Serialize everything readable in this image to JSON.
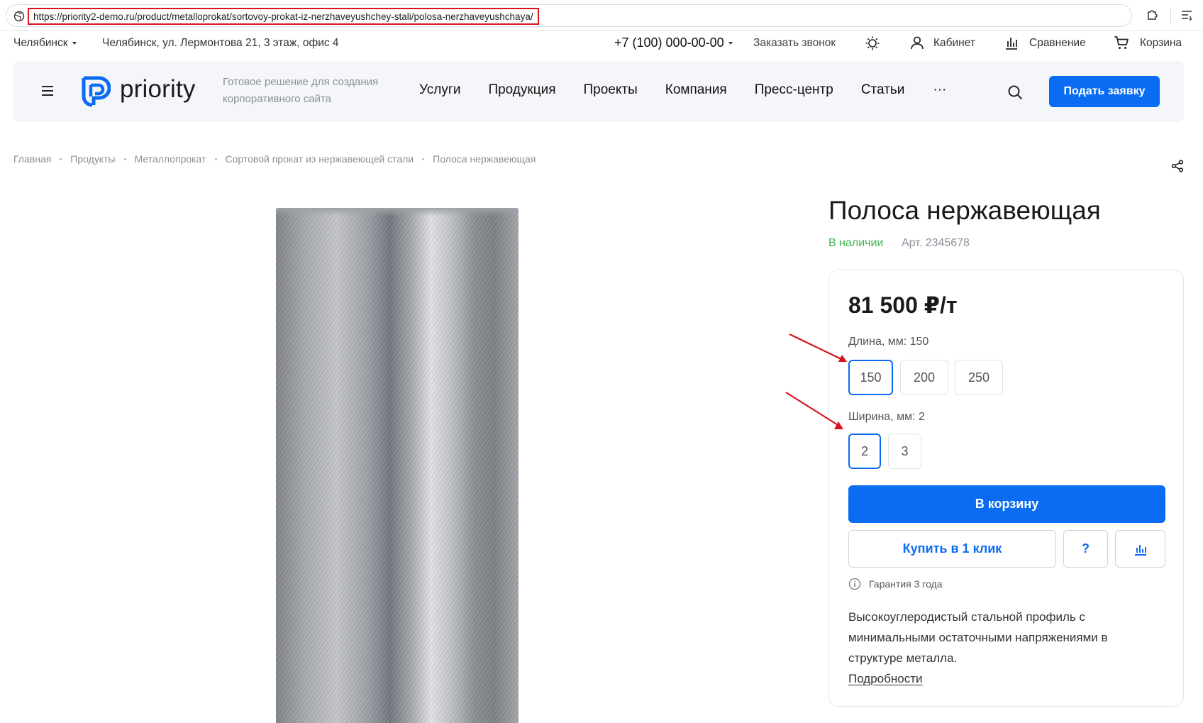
{
  "browser": {
    "url": "https://priority2-demo.ru/product/metalloprokat/sortovoy-prokat-iz-nerzhaveyushchey-stali/polosa-nerzhaveyushchaya/"
  },
  "topbar": {
    "city": "Челябинск",
    "address": "Челябинск, ул. Лермонтова 21, 3 этаж, офис 4",
    "phone": "+7 (100) 000-00-00",
    "callback": "Заказать звонок",
    "cabinet": "Кабинет",
    "compare": "Сравнение",
    "cart": "Корзина"
  },
  "header": {
    "logo_text": "priority",
    "tagline": "Готовое решение для создания корпоративного сайта",
    "nav": [
      "Услуги",
      "Продукция",
      "Проекты",
      "Компания",
      "Пресс-центр",
      "Статьи",
      "···"
    ],
    "cta": "Подать заявку"
  },
  "breadcrumbs": [
    "Главная",
    "Продукты",
    "Металлопрокат",
    "Сортовой прокат из нержавеющей стали",
    "Полоса нержавеющая"
  ],
  "product": {
    "title": "Полоса нержавеющая",
    "stock": "В наличии",
    "sku": "Арт. 2345678",
    "price": "81 500 ₽/т",
    "length_label": "Длина, мм: 150",
    "length_options": [
      "150",
      "200",
      "250"
    ],
    "length_selected": "150",
    "width_label": "Ширина, мм: 2",
    "width_options": [
      "2",
      "3"
    ],
    "width_selected": "2",
    "cart_button": "В корзину",
    "one_click_button": "Купить в 1 клик",
    "ask_button": "?",
    "warranty": "Гарантия 3 года",
    "description": "Высокоуглеродистый стальной профиль с минимальными остаточными напряжениями в структуре металла.",
    "more_link": "Подробности"
  },
  "colors": {
    "accent": "#0a6cf2",
    "stock_green": "#3cb54a",
    "annotation_red": "#d9121c"
  }
}
